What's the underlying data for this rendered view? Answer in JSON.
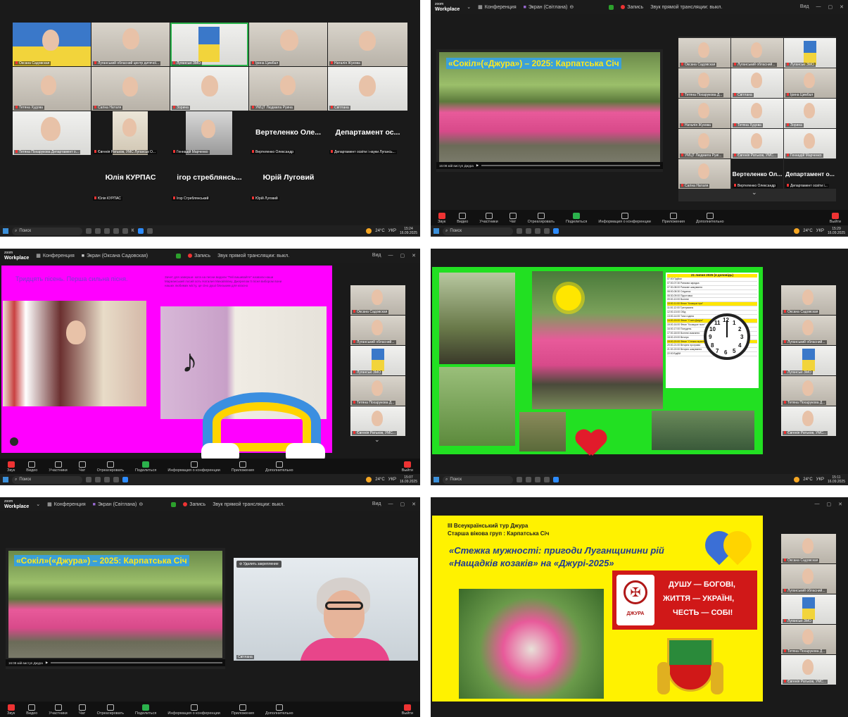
{
  "app": {
    "logo_top": "zoom",
    "logo_bottom": "Workplace",
    "conference_label": "Конференция",
    "record_label": "Запись",
    "stream_label": "Звук прямой трансляции: выкл.",
    "view_label": "Вид"
  },
  "toolbar": {
    "sound": "Звук",
    "video": "Видео",
    "participants": "Участники",
    "participants_count": "16",
    "chat": "Чат",
    "react": "Отреагировать",
    "share": "Поделиться",
    "info": "Информация о конференции",
    "apps": "Приложения",
    "more": "Дополнительно",
    "leave": "Выйти"
  },
  "taskbar": {
    "search": "Поиск",
    "temp": "24°C",
    "lang": "УКР",
    "date": "16.09.2025",
    "times": [
      "15:24",
      "15:29",
      "15:07",
      "15:11"
    ],
    "app_k": "К",
    "app_z": "Z"
  },
  "panel1": {
    "tiles": [
      {
        "name": "Оксана Садовская"
      },
      {
        "name": "Луганський обласний центр дитячої..."
      },
      {
        "name": "Луганські ЗМО"
      },
      {
        "name": "Ірина Цимбал"
      },
      {
        "name": "Наталія Жукова"
      },
      {
        "name": "Тетяна Худова"
      },
      {
        "name": "Сагіна Наталя"
      },
      {
        "name": "Зорина"
      },
      {
        "name": "УМЦТ Людмила Руина"
      },
      {
        "name": "Світлана"
      },
      {
        "name": "Тетяна Похарукова Департамент о..."
      },
      {
        "name": "Євгенія Ратьков, УМС Луганськ О..."
      },
      {
        "name": "Геннадій Марченко"
      },
      {
        "name": "Вертеленко Олександр",
        "big": "Вертеленко Оле..."
      },
      {
        "name": "Департамент освіти і науки Лугансь...",
        "big": "Департамент ос..."
      },
      {
        "name": "Юлія КУРПАС",
        "big": "Юлія КУРПАС"
      },
      {
        "name": "Ігор Стреблянський",
        "big": "ігор стреблянсь..."
      },
      {
        "name": "Юрій Луговий",
        "big": "Юрій Луговий"
      }
    ]
  },
  "panel2": {
    "share_label": "Экран (Світлана)",
    "slide_title": "«Сокіл»(«Джура») – 2025: Карпатська Січ",
    "player_caption": "16:08 мій виступ Джура",
    "tiles": [
      {
        "name": "Оксана Садовская"
      },
      {
        "name": "Луганський обласний..."
      },
      {
        "name": "Луганські ЗМО"
      },
      {
        "name": "Тетяна Похарукова Д..."
      },
      {
        "name": "Світлана"
      },
      {
        "name": "Ірина Цимбал"
      },
      {
        "name": "Наталія Жукова"
      },
      {
        "name": "Тетяна Худова"
      },
      {
        "name": "Зорина"
      },
      {
        "name": "УМЦТ Людмила Руиі..."
      },
      {
        "name": "Євгенія Ратьков, УМС..."
      },
      {
        "name": "Геннадій Марченко"
      },
      {
        "name": "Сагіна Наталя"
      },
      {
        "name": "Вертеленко Олександр",
        "big": "Вертеленко Ол..."
      },
      {
        "name": "Департамент освіти і...",
        "big": "Департамент о..."
      }
    ]
  },
  "panel3": {
    "share_label": "Экран (Оксана Садовская)",
    "slide_heading": "Тридцять пісень. Перша сильна пісня.",
    "slide_text": "Зачет для заверши- ката на песни видали \"Гей вишивайте\" назвали наши Марианський лосий хоть Наталия Михайлівну. Джерелом її пісня вибором вони наших любимих місту, це сіно душі близьким для класно",
    "tiles": [
      {
        "name": "Оксана Садовская"
      },
      {
        "name": "Луганський обласний..."
      },
      {
        "name": "Луганські ЗМО"
      },
      {
        "name": "Тетяна Похарукова Д..."
      },
      {
        "name": "Євгенія Ратьков, УМС..."
      }
    ]
  },
  "panel4": {
    "schedule_title": "21 липня 2025 (4 доповідь)",
    "schedule_rows": [
      "07:00 Підйом",
      "07:00-07:30 Ранкова зарядка",
      "07:30-08:00 Ранкове шикування",
      "08:00-08:30 Сніданок",
      "08:30-09:00 Підготовка",
      "09:00-10:00 Вогневі",
      "10:00-11:00 Фінал \"Козацькі ігри\"",
      "11:00-12:00 Тренування",
      "12:00-13:00 Обід",
      "13:00-14:00 Тиха година",
      "14:00-15:00 Фінал \"Сокіл-Джура\"",
      "15:00-16:00 Фінал \"Козацьке поле\"",
      "16:00-17:00 Полудень",
      "17:00-18:00 Вогневі змагання",
      "18:00-19:00 Вечеря",
      "19:00-20:00 Фінал \"Стежка мужності\"",
      "20:00-21:00 Вечірня програма",
      "21:00-22:00 Вечірнє шикування",
      "22:00 Відбій"
    ],
    "clock_numbers": [
      "12",
      "3",
      "6",
      "9",
      "1",
      "2",
      "4",
      "5",
      "7",
      "8",
      "10",
      "11"
    ],
    "tiles": [
      {
        "name": "Оксана Садовская"
      },
      {
        "name": "Луганський обласний..."
      },
      {
        "name": "Луганські ЗМО"
      },
      {
        "name": "Тетяна Похарукова Д..."
      },
      {
        "name": "Євгенія Ратьков, УМС..."
      }
    ]
  },
  "panel5": {
    "share_label": "Экран (Світлана)",
    "slide_title": "«Сокіл»(«Джура») – 2025: Карпатська Січ",
    "player_caption": "16:08 мій виступ Джура",
    "unpin_label": "Удалить закрепление",
    "speaker_name": "Світлана"
  },
  "panel6": {
    "line1": "ІІІ Всеукраїнський тур Джура",
    "line2": "Старша вікова груп : Карпатська Січ",
    "title1": "«Стежка мужності: пригоди Луганщинини рій",
    "title2": "«Нащадків козаків» на «Джурі-2025»",
    "motto1": "ДУШУ — БОГОВІ,",
    "motto2": "ЖИТТЯ — УКРАЇНІ,",
    "motto3": "ЧЕСТЬ — СОБІ!",
    "emblem_label": "ДЖУРА",
    "tiles": [
      {
        "name": "Оксана Садовская"
      },
      {
        "name": "Луганський обласний..."
      },
      {
        "name": "Луганські ЗМО"
      },
      {
        "name": "Тетяна Похарукова Д..."
      },
      {
        "name": "Євгенія Ратьков, УМС..."
      }
    ]
  },
  "colors": {
    "zoom_bg": "#1a1a1a",
    "slide_magenta": "#ff00ff",
    "slide_green": "#22e022",
    "slide_yellow": "#fff200",
    "title_yellow": "#ffe81a",
    "accent_green": "#2bb24c",
    "record_red": "#e33333"
  }
}
